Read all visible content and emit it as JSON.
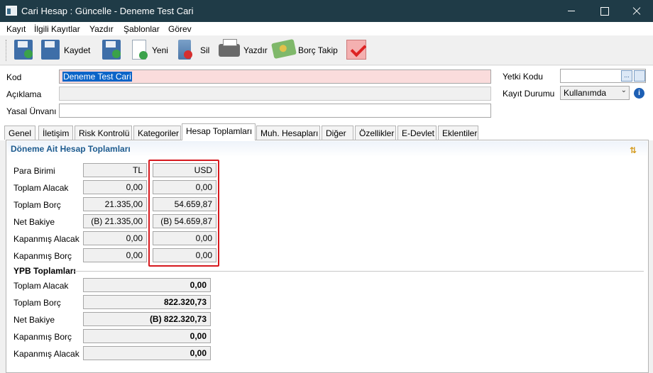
{
  "window": {
    "title": "Cari Hesap : Güncelle - Deneme Test Cari"
  },
  "menu": [
    "Kayıt",
    "İlgili Kayıtlar",
    "Yazdır",
    "Şablonlar",
    "Görev"
  ],
  "toolbar": {
    "save": "Kaydet",
    "new": "Yeni",
    "delete": "Sil",
    "print": "Yazdır",
    "debt": "Borç Takip"
  },
  "form": {
    "kod_label": "Kod",
    "kod_value": "Deneme Test Cari",
    "aciklama_label": "Açıklama",
    "aciklama_value": "",
    "yasal_label": "Yasal Ünvanı",
    "yasal_value": "",
    "yetki_label": "Yetki Kodu",
    "yetki_value": "",
    "durum_label": "Kayıt Durumu",
    "durum_value": "Kullanımda",
    "more_button": "...",
    "info": "i"
  },
  "tabs": [
    "Genel",
    "İletişim",
    "Risk Kontrolü",
    "Kategoriler",
    "Hesap Toplamları",
    "Muh. Hesapları",
    "Diğer",
    "Özellikler",
    "E-Devlet",
    "Eklentiler"
  ],
  "active_tab": "Hesap Toplamları",
  "section": {
    "title": "Döneme Ait Hesap Toplamları",
    "rows": [
      {
        "label": "Para Birimi",
        "tl": "TL",
        "usd": "USD"
      },
      {
        "label": "Toplam Alacak",
        "tl": "0,00",
        "usd": "0,00"
      },
      {
        "label": "Toplam Borç",
        "tl": "21.335,00",
        "usd": "54.659,87"
      },
      {
        "label": "Net Bakiye",
        "tl": "(B) 21.335,00",
        "usd": "(B) 54.659,87"
      },
      {
        "label": "Kapanmış Alacak",
        "tl": "0,00",
        "usd": "0,00"
      },
      {
        "label": "Kapanmış Borç",
        "tl": "0,00",
        "usd": "0,00"
      }
    ]
  },
  "ypb": {
    "title": "YPB Toplamları",
    "rows": [
      {
        "label": "Toplam Alacak",
        "value": "0,00"
      },
      {
        "label": "Toplam Borç",
        "value": "822.320,73"
      },
      {
        "label": "Net Bakiye",
        "value": "(B) 822.320,73"
      },
      {
        "label": "Kapanmış Borç",
        "value": "0,00"
      },
      {
        "label": "Kapanmış Alacak",
        "value": "0,00"
      }
    ]
  },
  "colors": {
    "titlebar": "#1f3b47",
    "accent": "#1d5b8f",
    "highlight": "#d6191e",
    "required": "#fadcdc"
  }
}
